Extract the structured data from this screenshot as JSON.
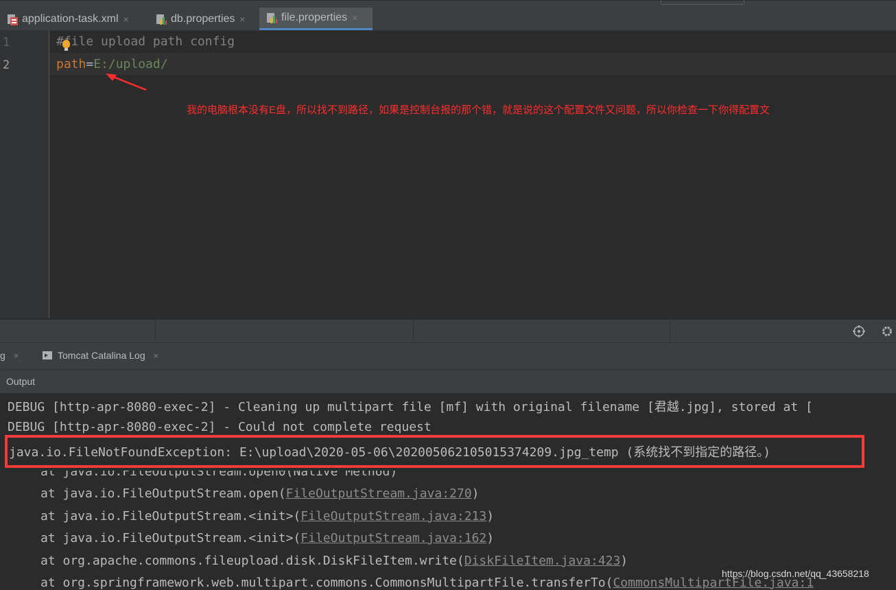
{
  "editor_tabs": [
    {
      "label": "application-task.xml",
      "icon": "xml-file-icon",
      "active": false
    },
    {
      "label": "db.properties",
      "icon": "properties-file-icon",
      "active": false
    },
    {
      "label": "file.properties",
      "icon": "properties-file-icon",
      "active": true
    }
  ],
  "tab_close_glyph": "×",
  "editor": {
    "line_numbers": [
      "1",
      "2"
    ],
    "line1": {
      "text": "#file upload path config"
    },
    "line2": {
      "key": "path",
      "eq": "=",
      "value": "E:/upload/"
    }
  },
  "annotation_text": "我的电脑根本没有E盘，所以找不到路径，如果是控制台报的那个错，就是说的这个配置文件又问题，所以你检查一下你得配置文",
  "tool_window": {
    "tabs": [
      {
        "label": "g"
      },
      {
        "label": "Tomcat Catalina Log"
      }
    ],
    "section_label": "Output"
  },
  "console": {
    "lines": [
      "DEBUG [http-apr-8080-exec-2] - Cleaning up multipart file [mf] with original filename [君越.jpg], stored at [",
      "DEBUG [http-apr-8080-exec-2] - Could not complete request",
      "java.io.FileNotFoundException: E:\\upload\\2020-05-06\\20200506210501537420‌9.jpg_temp (系统找不到指定的路径。)"
    ],
    "stack": [
      {
        "prefix": "at java.io.FileOutputStream.open0(Native Method)",
        "link": "",
        "suffix": ""
      },
      {
        "prefix": "at java.io.FileOutputStream.open(",
        "link": "FileOutputStream.java:270",
        "suffix": ")"
      },
      {
        "prefix": "at java.io.FileOutputStream.<init>(",
        "link": "FileOutputStream.java:213",
        "suffix": ")"
      },
      {
        "prefix": "at java.io.FileOutputStream.<init>(",
        "link": "FileOutputStream.java:162",
        "suffix": ")"
      },
      {
        "prefix": "at org.apache.commons.fileupload.disk.DiskFileItem.write(",
        "link": "DiskFileItem.java:423",
        "suffix": ")"
      },
      {
        "prefix": "at org.springframework.web.multipart.commons.CommonsMultipartFile.transferTo(",
        "link": "CommonsMultipartFile.java:1",
        "suffix": ""
      }
    ]
  },
  "watermark": "https://blog.csdn.net/qq_43658218",
  "colors": {
    "annotation": "#ff2d2d",
    "highlight_box": "#f03c3c",
    "property_key": "#cc7832",
    "property_value": "#6a8759"
  }
}
